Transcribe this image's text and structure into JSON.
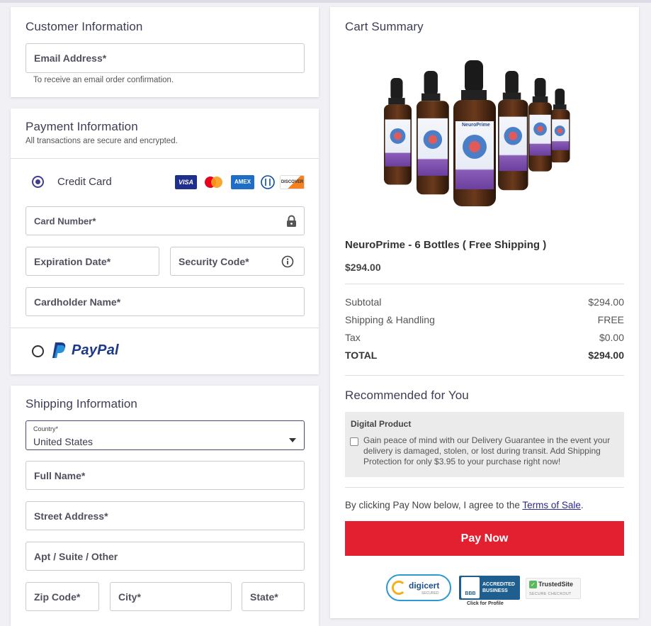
{
  "customer": {
    "title": "Customer Information",
    "email_label": "Email Address*",
    "email_hint": "To receive an email order confirmation."
  },
  "payment": {
    "title": "Payment Information",
    "subtitle": "All transactions are secure and encrypted.",
    "credit_card_label": "Credit Card",
    "card_brands": [
      "VISA",
      "AMEX",
      "DISCOVER"
    ],
    "card_number_label": "Card Number*",
    "expiration_label": "Expiration Date*",
    "security_code_label": "Security Code*",
    "cardholder_label": "Cardholder Name*",
    "paypal_label": "PayPal"
  },
  "shipping": {
    "title": "Shipping Information",
    "country_label": "Country*",
    "country_value": "United States",
    "full_name_label": "Full Name*",
    "street_label": "Street Address*",
    "apt_label": "Apt / Suite / Other",
    "zip_label": "Zip Code*",
    "city_label": "City*",
    "state_label": "State*"
  },
  "cart": {
    "title": "Cart Summary",
    "product_name": "NeuroPrime - 6 Bottles ( Free Shipping )",
    "product_price": "$294.00",
    "bottle_brand": "NeuroPrime",
    "subtotal_label": "Subtotal",
    "subtotal_value": "$294.00",
    "shipping_label": "Shipping & Handling",
    "shipping_value": "FREE",
    "tax_label": "Tax",
    "tax_value": "$0.00",
    "total_label": "TOTAL",
    "total_value": "$294.00"
  },
  "recommended": {
    "title": "Recommended for You",
    "box_title": "Digital Product",
    "box_text": "Gain peace of mind with our Delivery Guarantee in the event your delivery is damaged, stolen, or lost during transit. Add Shipping Protection for only $3.95 to your purchase right now!"
  },
  "terms": {
    "prefix": "By clicking Pay Now below, I agree to the ",
    "link": "Terms of Sale",
    "suffix": "."
  },
  "pay_button_label": "Pay Now",
  "badges": {
    "digicert": "digicert",
    "digicert_sub": "SECURED",
    "bbb_line1": "ACCREDITED",
    "bbb_line2": "BUSINESS",
    "bbb_mark": "BBB",
    "bbb_sub": "Click for Profile",
    "trusted": "TrustedSite",
    "trusted_sub": "SECURE CHECKOUT"
  },
  "colors": {
    "accent": "#3f3e94",
    "pay_button": "#e3202f",
    "link": "#2a2a8c"
  }
}
